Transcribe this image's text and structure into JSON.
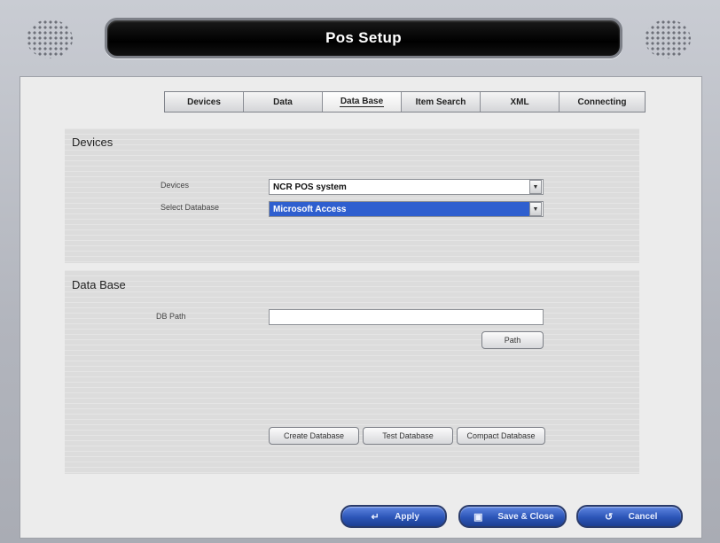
{
  "window": {
    "title": "Pos Setup"
  },
  "tabs": [
    {
      "label": "Devices"
    },
    {
      "label": "Data"
    },
    {
      "label": "Data Base"
    },
    {
      "label": "Item Search"
    },
    {
      "label": "XML"
    },
    {
      "label": "Connecting"
    }
  ],
  "active_tab": "Data Base",
  "devices_panel": {
    "title": "Devices",
    "devices_label": "Devices",
    "devices_value": "NCR POS system",
    "select_db_label": "Select Database",
    "select_db_value": "Microsoft Access"
  },
  "database_panel": {
    "title": "Data Base",
    "db_path_label": "DB Path",
    "db_path_value": "",
    "path_button": "Path",
    "create_button": "Create Database",
    "test_button": "Test Database",
    "compact_button": "Compact Database"
  },
  "footer": {
    "apply": "Apply",
    "save_close": "Save & Close",
    "cancel": "Cancel"
  },
  "colors": {
    "accent_blue": "#2c55b7",
    "selection_blue": "#2f5fcf",
    "title_bar": "#000000"
  },
  "icons": {
    "apply": "enter-arrow-icon",
    "save_close": "save-icon",
    "cancel": "undo-icon",
    "dropdown": "chevron-down-icon"
  }
}
